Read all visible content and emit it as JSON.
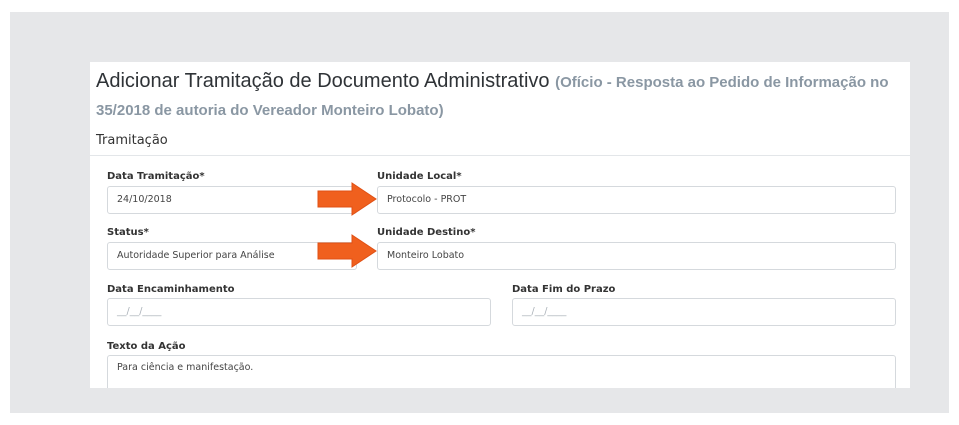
{
  "form": {
    "title_main": "Adicionar Tramitação de Documento Administrativo",
    "title_sub": "(Ofício - Resposta ao Pedido de Informação no 35/2018 de autoria do Vereador Monteiro Lobato)",
    "section": "Tramitação",
    "data_tramitacao": {
      "label": "Data Tramitação*",
      "value": "24/10/2018"
    },
    "unidade_local": {
      "label": "Unidade Local*",
      "value": "Protocolo - PROT"
    },
    "status": {
      "label": "Status*",
      "value": "Autoridade Superior para Análise"
    },
    "unidade_destino": {
      "label": "Unidade Destino*",
      "value": "Monteiro Lobato"
    },
    "data_encaminhamento": {
      "label": "Data Encaminhamento",
      "placeholder": "__/__/____"
    },
    "data_fim_prazo": {
      "label": "Data Fim do Prazo",
      "placeholder": "__/__/____"
    },
    "texto_acao": {
      "label": "Texto da Ação",
      "value": "Para ciência e manifestação."
    }
  },
  "colors": {
    "accent_arrow": "#f0601e",
    "background": "#e6e7e9",
    "subtitle": "#8a97a3"
  },
  "icons": [
    "arrow-right-icon",
    "arrow-right-icon"
  ]
}
